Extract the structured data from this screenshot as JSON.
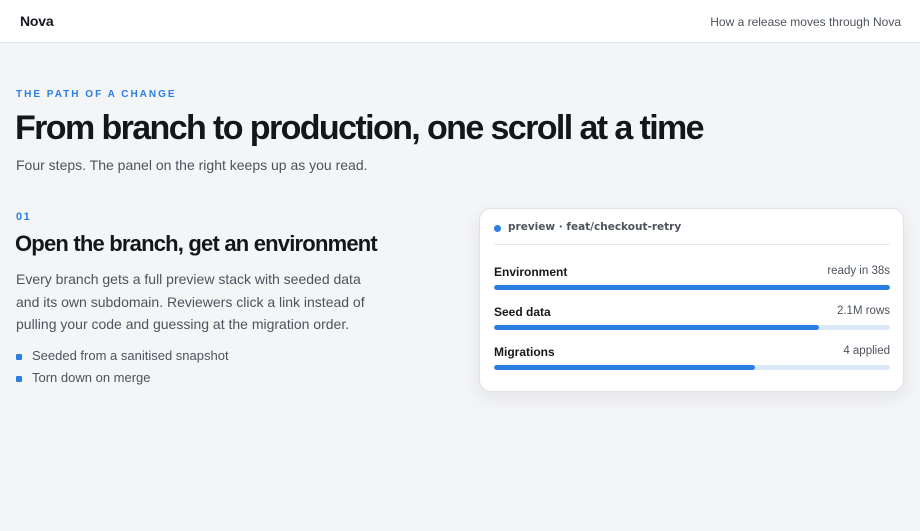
{
  "header": {
    "brand": "Nova",
    "nav_link": "How a release moves through Nova"
  },
  "hero": {
    "eyebrow": "THE PATH OF A CHANGE",
    "title": "From branch to production, one scroll at a time",
    "subtitle": "Four steps. The panel on the right keeps up as you read."
  },
  "step": {
    "number": "01",
    "title": "Open the branch, get an environment",
    "body": "Every branch gets a full preview stack with seeded data and its own subdomain. Reviewers click a link instead of pulling your code and guessing at the migration order.",
    "bullets": [
      "Seeded from a sanitised snapshot",
      "Torn down on merge"
    ]
  },
  "panel": {
    "branch": "preview · feat/checkout-retry",
    "rows": [
      {
        "label": "Environment",
        "value": "ready in 38s",
        "progress": 1.0
      },
      {
        "label": "Seed data",
        "value": "2.1M rows",
        "progress": 0.82
      },
      {
        "label": "Migrations",
        "value": "4 applied",
        "progress": 0.66
      }
    ]
  },
  "colors": {
    "accent": "#2b7fe0",
    "track": "#dce8f7",
    "background": "#f4f5f7"
  }
}
